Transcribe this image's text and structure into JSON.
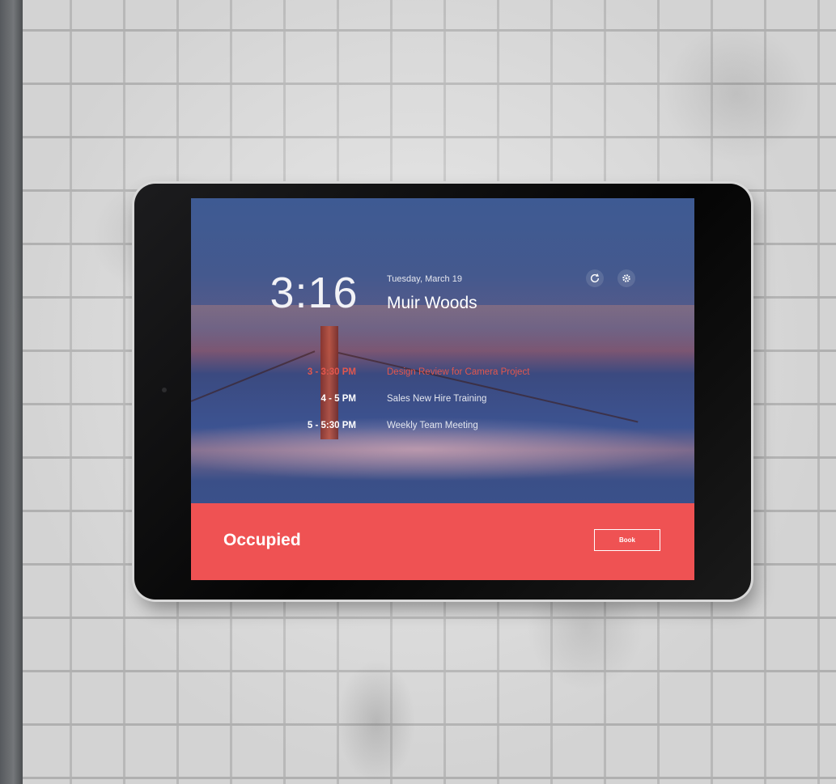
{
  "room_display": {
    "clock": "3:16",
    "date": "Tuesday, March 19",
    "room_name": "Muir Woods",
    "icons": [
      "refresh-icon",
      "gear-icon"
    ],
    "schedule": [
      {
        "time": "3 - 3:30 PM",
        "title": "Design Review for Camera Project",
        "state": "current"
      },
      {
        "time": "4 - 5 PM",
        "title": "Sales New Hire Training",
        "state": "upcoming"
      },
      {
        "time": "5 - 5:30 PM",
        "title": "Weekly Team Meeting",
        "state": "upcoming"
      }
    ],
    "status": {
      "label": "Occupied",
      "button_label": "Book",
      "color": "#ef5253"
    }
  }
}
